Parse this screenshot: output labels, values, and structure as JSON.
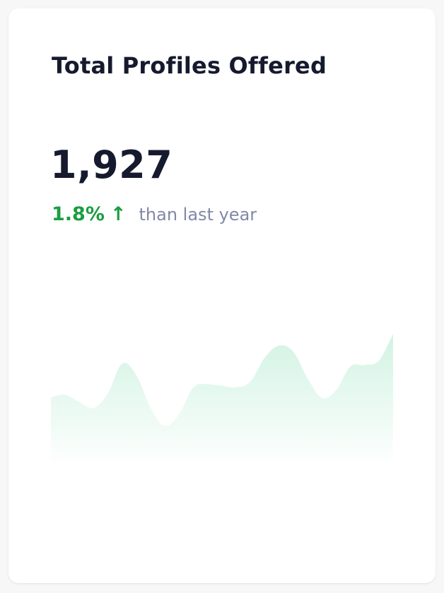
{
  "card": {
    "title": "Total Profiles Offered",
    "value": "1,927",
    "change": {
      "percent": "1.8%",
      "arrow": "↑",
      "label": "than last year"
    }
  },
  "colors": {
    "title": "#161a2e",
    "positive": "#1a9e3f",
    "muted": "#8288a6",
    "area_fill": "#d2f3e3"
  },
  "chart_data": {
    "type": "area",
    "x": [
      0,
      1,
      2,
      3,
      4,
      5,
      6,
      7,
      8,
      9,
      10,
      11,
      12,
      13,
      14,
      15,
      16,
      17,
      18,
      19,
      20,
      21,
      22,
      23,
      24
    ],
    "values": [
      47,
      49,
      44,
      40,
      50,
      70,
      62,
      40,
      28,
      36,
      54,
      56,
      55,
      54,
      58,
      74,
      82,
      78,
      60,
      47,
      52,
      68,
      69,
      72,
      90
    ],
    "ylim": [
      0,
      100
    ],
    "grid": false,
    "legend": "none",
    "title": "",
    "xlabel": "",
    "ylabel": ""
  }
}
